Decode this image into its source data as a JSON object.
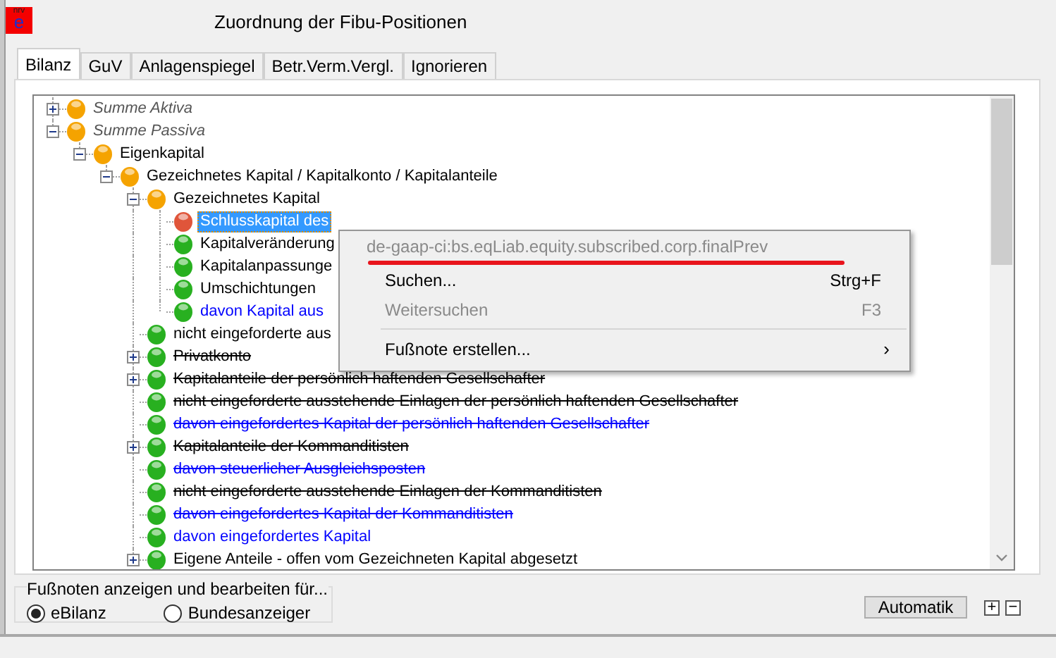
{
  "window": {
    "title": "Zuordnung der Fibu-Positionen",
    "logo_top": "nrv",
    "logo_letter": "e"
  },
  "tabs": [
    {
      "label": "Bilanz",
      "selected": true
    },
    {
      "label": "GuV",
      "selected": false
    },
    {
      "label": "Anlagenspiegel",
      "selected": false
    },
    {
      "label": "Betr.Verm.Vergl.",
      "selected": false
    },
    {
      "label": "Ignorieren",
      "selected": false
    }
  ],
  "tree": {
    "items": [
      {
        "text": "Summe Aktiva",
        "color": "#f5a300",
        "kind": "sum",
        "struck": false,
        "selected": false,
        "expanded": false
      },
      {
        "text": "Summe Passiva",
        "color": "#f5a300",
        "kind": "sum",
        "struck": false,
        "selected": false,
        "expanded": true,
        "children": [
          {
            "text": "Eigenkapital",
            "color": "#f5a300",
            "kind": "normal",
            "struck": false,
            "selected": false,
            "expanded": true,
            "children": [
              {
                "text": "Gezeichnetes Kapital / Kapitalkonto / Kapitalanteile",
                "color": "#f5a300",
                "kind": "normal",
                "struck": false,
                "selected": false,
                "expanded": true,
                "children": [
                  {
                    "text": "Gezeichnetes Kapital",
                    "color": "#f5a300",
                    "kind": "normal",
                    "struck": false,
                    "selected": false,
                    "expanded": true,
                    "children": [
                      {
                        "text": "Schlusskapital des",
                        "color": "#e0553a",
                        "kind": "normal",
                        "struck": false,
                        "selected": true
                      },
                      {
                        "text": "Kapitalveränderung",
                        "color": "#28b020",
                        "kind": "normal",
                        "struck": false,
                        "selected": false
                      },
                      {
                        "text": "Kapitalanpassunge",
                        "color": "#28b020",
                        "kind": "normal",
                        "struck": false,
                        "selected": false
                      },
                      {
                        "text": "Umschichtungen",
                        "color": "#28b020",
                        "kind": "normal",
                        "struck": false,
                        "selected": false
                      },
                      {
                        "text": "davon Kapital aus",
                        "color": "#28b020",
                        "kind": "derived",
                        "struck": false,
                        "selected": false
                      }
                    ]
                  },
                  {
                    "text": "nicht eingeforderte aus",
                    "color": "#28b020",
                    "kind": "normal",
                    "struck": false,
                    "selected": false
                  },
                  {
                    "text": "Privatkonto",
                    "color": "#28b020",
                    "kind": "normal",
                    "struck": true,
                    "selected": false,
                    "expanded": false
                  },
                  {
                    "text": "Kapitalanteile der persönlich haftenden Gesellschafter",
                    "color": "#28b020",
                    "kind": "normal",
                    "struck": true,
                    "selected": false,
                    "expanded": false
                  },
                  {
                    "text": "nicht eingeforderte ausstehende Einlagen der persönlich haftenden Gesellschafter",
                    "color": "#28b020",
                    "kind": "normal",
                    "struck": true,
                    "selected": false
                  },
                  {
                    "text": "davon eingefordertes Kapital der persönlich haftenden Gesellschafter",
                    "color": "#28b020",
                    "kind": "derived",
                    "struck": true,
                    "selected": false
                  },
                  {
                    "text": "Kapitalanteile der Kommanditisten",
                    "color": "#28b020",
                    "kind": "normal",
                    "struck": true,
                    "selected": false,
                    "expanded": false
                  },
                  {
                    "text": "davon steuerlicher Ausgleichsposten",
                    "color": "#28b020",
                    "kind": "derived",
                    "struck": true,
                    "selected": false
                  },
                  {
                    "text": "nicht eingeforderte ausstehende Einlagen der Kommanditisten",
                    "color": "#28b020",
                    "kind": "normal",
                    "struck": true,
                    "selected": false
                  },
                  {
                    "text": "davon eingefordertes Kapital der Kommanditisten",
                    "color": "#28b020",
                    "kind": "derived",
                    "struck": true,
                    "selected": false
                  },
                  {
                    "text": "davon eingefordertes Kapital",
                    "color": "#28b020",
                    "kind": "derived",
                    "struck": false,
                    "selected": false
                  },
                  {
                    "text": "Eigene Anteile - offen vom Gezeichneten Kapital abgesetzt",
                    "color": "#28b020",
                    "kind": "normal",
                    "struck": false,
                    "selected": false,
                    "expanded": false
                  }
                ]
              }
            ]
          }
        ]
      }
    ]
  },
  "context_menu": {
    "header": "de-gaap-ci:bs.eqLiab.equity.subscribed.corp.finalPrev",
    "items": [
      {
        "kind": "command",
        "label": "Suchen...",
        "shortcut": "Strg+F",
        "disabled": false
      },
      {
        "kind": "command",
        "label": "Weitersuchen",
        "shortcut": "F3",
        "disabled": true
      },
      {
        "kind": "separator"
      },
      {
        "kind": "submenu",
        "label": "Fußnote erstellen...",
        "arrow": "›",
        "disabled": false
      }
    ]
  },
  "footnotes": {
    "legend": "Fußnoten anzeigen und bearbeiten für...",
    "options": [
      {
        "label": "eBilanz",
        "selected": true
      },
      {
        "label": "Bundesanzeiger",
        "selected": false
      }
    ]
  },
  "buttons": {
    "automatik": "Automatik",
    "plus": "+",
    "minus": "−"
  }
}
